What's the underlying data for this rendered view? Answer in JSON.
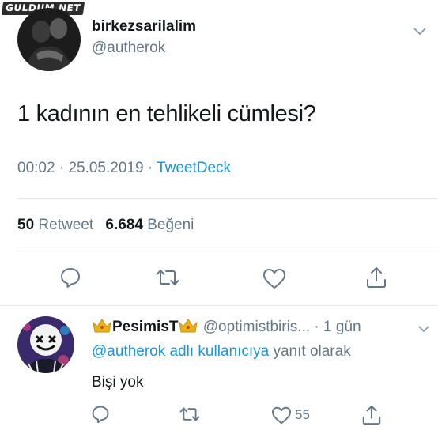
{
  "watermark": "GULDUM.NET",
  "tweet": {
    "display_name": "birkezsarilalim",
    "handle": "@autherok",
    "text": "1 kadının en tehlikeli cümlesi?",
    "time": "00:02",
    "date": "25.05.2019",
    "source": "TweetDeck",
    "separator": "·",
    "retweet_count": "50",
    "retweet_label": "Retweet",
    "like_count": "6.684",
    "like_label": "Beğeni"
  },
  "reply": {
    "display_name": "PesimisT",
    "handle": "@optimistbiris...",
    "age": "· 1 gün",
    "mention": "@autherok adlı kullanıcıya",
    "reply_suffix": "yanıt olarak",
    "text": "Bişi yok",
    "like_count": "55"
  },
  "icons": [
    "reply-icon",
    "retweet-icon",
    "like-icon",
    "share-icon",
    "crown-icon",
    "chevron-down-icon"
  ],
  "colors": {
    "link": "#1b95e0",
    "secondary": "#657786",
    "primary_text": "#14171a",
    "divider": "#e1e8ed",
    "crown": "#e9b21a"
  }
}
